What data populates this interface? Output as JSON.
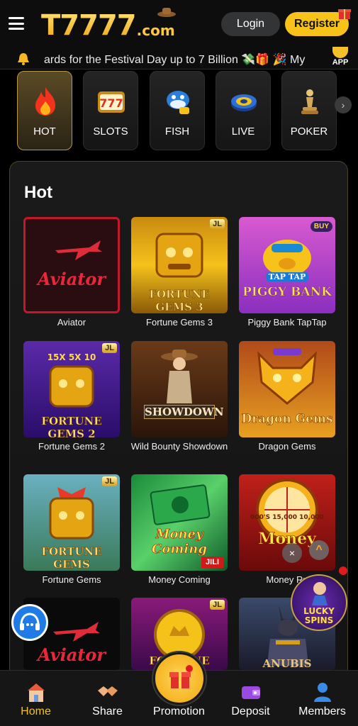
{
  "header": {
    "logo_main": "T7777",
    "logo_suffix": ".com",
    "login_label": "Login",
    "register_label": "Register"
  },
  "marquee": {
    "text": "ards for the Festival Day up to 7 Billion 💸🎁   🎉 My"
  },
  "app_badge": {
    "label": "APP"
  },
  "categories": [
    {
      "label": "HOT",
      "icon": "flame-icon",
      "active": true
    },
    {
      "label": "SLOTS",
      "icon": "slot-777-icon",
      "active": false
    },
    {
      "label": "FISH",
      "icon": "shark-icon",
      "active": false
    },
    {
      "label": "LIVE",
      "icon": "roulette-icon",
      "active": false
    },
    {
      "label": "POKER",
      "icon": "chess-pawn-icon",
      "active": false
    }
  ],
  "section": {
    "title": "Hot"
  },
  "games": [
    {
      "name": "Aviator",
      "art_text": "Aviator"
    },
    {
      "name": "Fortune Gems 3",
      "art_text": "FORTUNE GEMS 3",
      "badge": "JL"
    },
    {
      "name": "Piggy Bank TapTap",
      "art_text": "PIGGY BANK",
      "art_sub": "TAP TAP",
      "badge": "BUY"
    },
    {
      "name": "Fortune Gems 2",
      "art_text": "FORTUNE GEMS 2",
      "badge": "JL",
      "art_sub": "15X  5X  10"
    },
    {
      "name": "Wild Bounty Showdown",
      "art_text": "SHOWDOWN"
    },
    {
      "name": "Dragon Gems",
      "art_text": "Dragon Gems"
    },
    {
      "name": "Fortune Gems",
      "art_text": "FORTUNE GEMS",
      "badge": "JL"
    },
    {
      "name": "Money Coming",
      "art_text": "Money Coming",
      "art_sub": "JILI"
    },
    {
      "name": "Money Ru",
      "art_text": "Money",
      "art_sub": "000'S  15,000  10,000"
    },
    {
      "name": "",
      "art_text": "Aviator"
    },
    {
      "name": "",
      "art_text": "FORTUNE",
      "badge": "JL"
    },
    {
      "name": "",
      "art_text": "ANUBIS"
    }
  ],
  "floating": {
    "lucky_spins": "LUCKY SPINS",
    "scroll_up": "^",
    "close": "×"
  },
  "bottom_nav": [
    {
      "label": "Home",
      "icon": "home-icon",
      "active": true
    },
    {
      "label": "Share",
      "icon": "handshake-icon",
      "active": false
    },
    {
      "label": "Promotion",
      "icon": "gift-icon",
      "active": false
    },
    {
      "label": "Deposit",
      "icon": "wallet-icon",
      "active": false
    },
    {
      "label": "Members",
      "icon": "user-icon",
      "active": false
    }
  ],
  "colors": {
    "accent": "#f7c21a",
    "background": "#000000",
    "panel_border": "#4a4220"
  }
}
